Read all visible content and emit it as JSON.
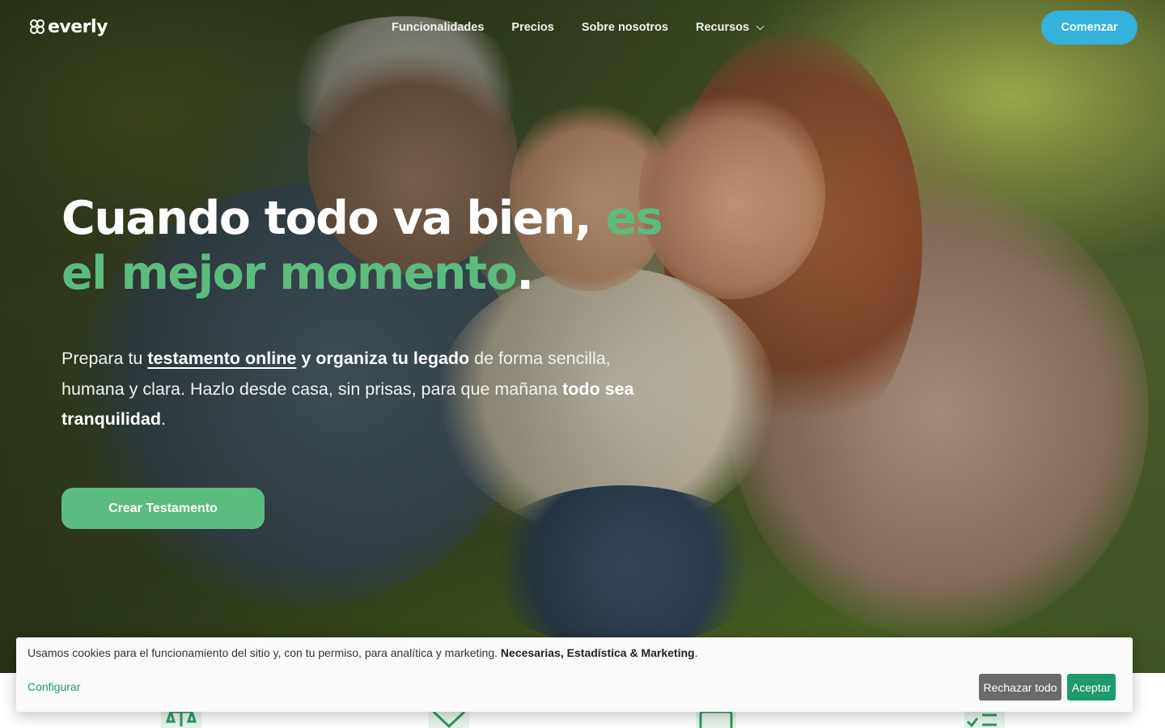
{
  "brand": {
    "name": "everly",
    "accent": "#5cbc7f",
    "cta_color": "#34b1dd"
  },
  "nav": {
    "items": [
      {
        "label": "Funcionalidades"
      },
      {
        "label": "Precios"
      },
      {
        "label": "Sobre nosotros"
      },
      {
        "label": "Recursos",
        "icon": "chevron-down-icon"
      }
    ],
    "cta_label": "Comenzar"
  },
  "hero": {
    "headline_part1": "Cuando todo va bien, ",
    "headline_green": "es el mejor momento",
    "headline_end": ".",
    "lead": {
      "t1": "Prepara tu ",
      "link": "testamento online",
      "b1": " y organiza tu legado",
      "t2": " de forma sencilla, humana y clara. Hazlo desde casa, sin prisas, para que mañana ",
      "b2": "todo sea tranquilidad",
      "t3": "."
    },
    "cta_label": "Crear Testamento",
    "image": "family-photo"
  },
  "cookie_banner": {
    "text": "Usamos cookies para el funcionamiento del sitio y, con tu permiso, para analítica y marketing. ",
    "bold": "Necesarias, Estadística & Marketing",
    "end": ".",
    "configure_label": "Configurar",
    "reject_label": "Rechazar todo",
    "accept_label": "Aceptar"
  },
  "features": [
    {
      "icon": "scale-icon"
    },
    {
      "icon": "shield-check-icon"
    },
    {
      "icon": "document-icon"
    },
    {
      "icon": "checklist-icon"
    }
  ]
}
